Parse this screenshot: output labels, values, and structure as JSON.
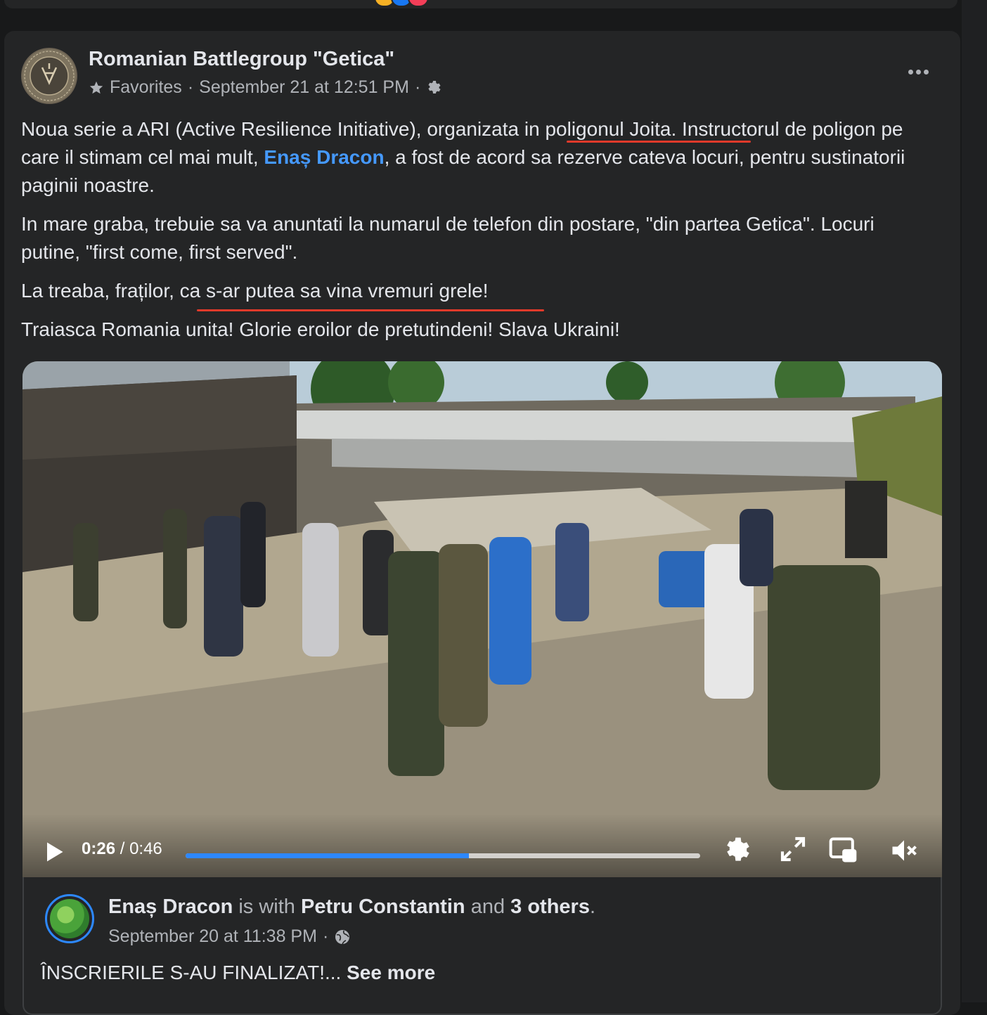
{
  "post": {
    "page_name": "Romanian Battlegroup \"Getica\"",
    "favorites_label": "Favorites",
    "separator": "·",
    "timestamp": "September 21 at 12:51 PM",
    "paragraphs": {
      "p1_a": "Noua serie a ARI (Active Resilience Initiative), organizata in poligonul Joita. Instructorul de poligon pe care il stimam cel mai mult, ",
      "p1_mention": "Enaș Dracon",
      "p1_b": ", a fost de acord sa rezerve cateva locuri, pentru sustinatorii paginii noastre.",
      "p2": "In mare graba, trebuie sa va anuntati la numarul de telefon din postare, \"din partea Getica\". Locuri putine, \"first come, first served\".",
      "p3": "La treaba, fraților, ca s-ar putea sa vina vremuri grele!",
      "p4": "Traiasca Romania unita! Glorie eroilor de pretutindeni! Slava Ukraini!"
    }
  },
  "video": {
    "current_time": "0:26",
    "divider": "/",
    "duration": "0:46",
    "progress_fraction": 0.55
  },
  "attached": {
    "author": "Enaș Dracon",
    "with_text": "is with",
    "tagged": "Petru Constantin",
    "and_text": "and",
    "others": "3 others",
    "period": ".",
    "timestamp": "September 20 at 11:38 PM",
    "separator": "·",
    "preview_text": "ÎNSCRIERILE S-AU FINALIZAT!...",
    "see_more": "See more"
  },
  "icons": {
    "favorites": "star-icon",
    "privacy_page": "gear-icon",
    "privacy_attached": "globe-icon",
    "more": "more-options-icon",
    "play": "play-icon",
    "settings": "settings-gear-icon",
    "fullscreen": "fullscreen-icon",
    "pip": "picture-in-picture-icon",
    "mute": "muted-speaker-icon"
  },
  "colors": {
    "card_bg": "#242526",
    "page_bg": "#18191a",
    "mention": "#4599ff",
    "progress_fill": "#2d88ff",
    "secondary_text": "#b0b3b8",
    "spellcheck": "#e03a2a"
  }
}
